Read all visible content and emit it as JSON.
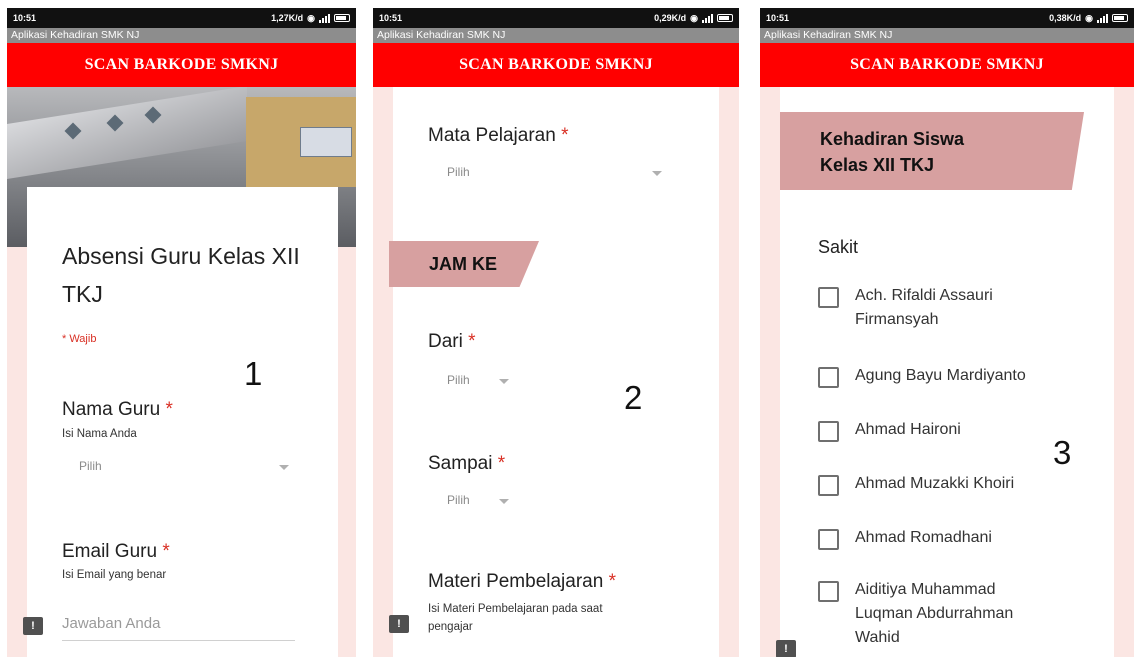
{
  "status_time": "10:51",
  "app_title": "Aplikasi Kehadiran SMK NJ",
  "header_title": "SCAN BARKODE SMKNJ",
  "phone1": {
    "speed": "1,27K/d",
    "form_title": "Absensi Guru Kelas XII TKJ",
    "required_note": "* Wajib",
    "step_number": "1",
    "nama_label": "Nama Guru",
    "nama_hint": "Isi Nama Anda",
    "nama_select": "Pilih",
    "email_label": "Email Guru",
    "email_hint": "Isi Email yang benar",
    "email_placeholder": "Jawaban Anda",
    "asterisk": "*"
  },
  "phone2": {
    "speed": "0,29K/d",
    "mapel_label": "Mata Pelajaran",
    "mapel_select": "Pilih",
    "section_title": "JAM KE",
    "step_number": "2",
    "dari_label": "Dari",
    "dari_select": "Pilih",
    "sampai_label": "Sampai",
    "sampai_select": "Pilih",
    "materi_label": "Materi Pembelajaran",
    "materi_hint_1": "Isi Materi Pembelajaran pada saat",
    "materi_hint_2": "pengajar",
    "asterisk": "*"
  },
  "phone3": {
    "speed": "0,38K/d",
    "section_title_1": "Kehadiran Siswa",
    "section_title_2": "Kelas XII TKJ",
    "group_label": "Sakit",
    "step_number": "3",
    "students": [
      {
        "line1": "Ach. Rifaldi Assauri",
        "line2": "Firmansyah",
        "line3": ""
      },
      {
        "line1": "Agung Bayu Mardiyanto",
        "line2": "",
        "line3": ""
      },
      {
        "line1": "Ahmad Haironi",
        "line2": "",
        "line3": ""
      },
      {
        "line1": "Ahmad Muzakki Khoiri",
        "line2": "",
        "line3": ""
      },
      {
        "line1": "Ahmad Romadhani",
        "line2": "",
        "line3": ""
      },
      {
        "line1": "Aiditiya Muhammad",
        "line2": "Luqman Abdurrahman",
        "line3": "Wahid"
      }
    ]
  },
  "feedback_glyph": "!"
}
